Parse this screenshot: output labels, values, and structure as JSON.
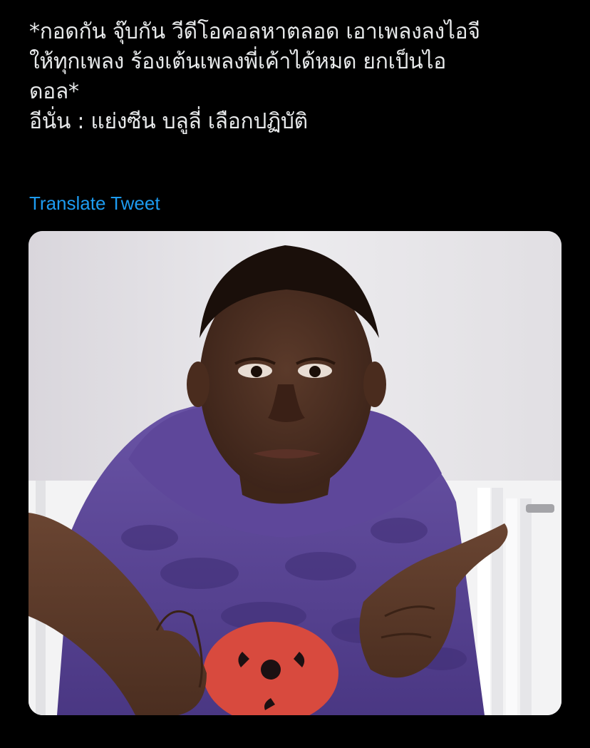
{
  "tweet": {
    "text_lines": [
      "*กอดกัน จุ๊บกัน วีดีโอคอลหาตลอด เอาเพลงลงไอจี",
      "ให้ทุกเพลง ร้องเต้นเพลงพี่เค้าได้หมด ยกเป็นไอ",
      "ดอล*",
      "อีนั่น : แย่งซีน บลูลี่ เลือกปฏิบัติ"
    ],
    "translate_label": "Translate Tweet"
  },
  "colors": {
    "background": "#000000",
    "text": "#E7E9EA",
    "link": "#1D9BF0",
    "hoodie": "#5B4596",
    "emblem": "#D84A3E"
  },
  "media": {
    "subject": "photo of a man in a purple hoodie shrugging with open palms"
  }
}
